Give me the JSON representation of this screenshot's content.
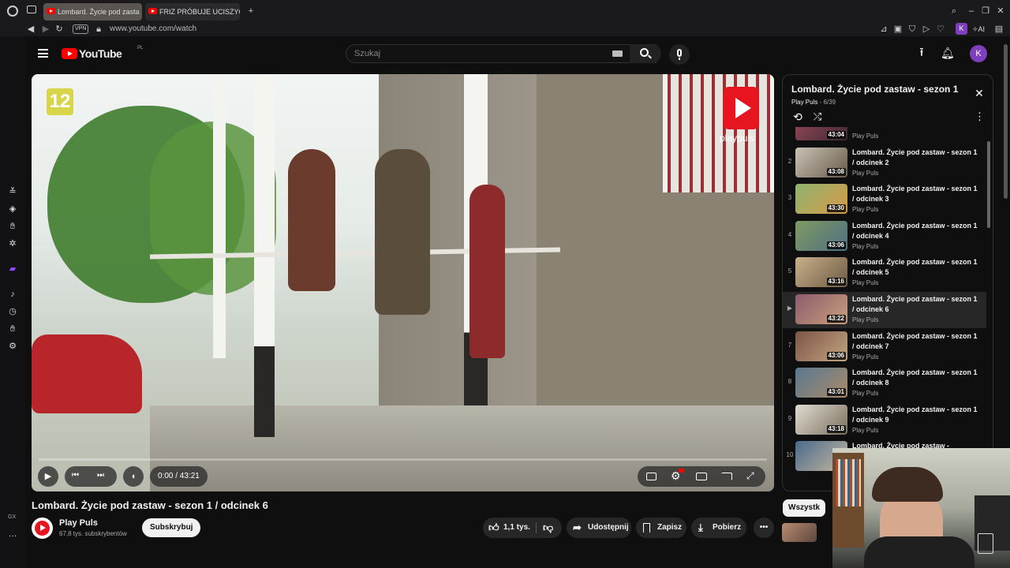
{
  "browser": {
    "tabs": [
      {
        "label": "Lombard. Życie pod zasta",
        "active": true
      },
      {
        "label": "FRIZ PRÓBUJE UCISZYĆ",
        "active": false
      }
    ],
    "vpn_label": "VPN",
    "url": "www.youtube.com/watch",
    "ai_label": "AI",
    "profile_letter": "K",
    "sidebar_bottom_label": "GX"
  },
  "header": {
    "logo_text": "YouTube",
    "region": "PL",
    "search_placeholder": "Szukaj",
    "avatar_letter": "K"
  },
  "player": {
    "channel_badge": "12",
    "watermark": "playpuls",
    "time": "0:00 / 43:21",
    "progress_fraction": 0.0
  },
  "video": {
    "title": "Lombard. Życie pod zastaw - sezon 1 / odcinek 6",
    "channel": "Play Puls",
    "subscribers": "67,8 tys. subskrybentów",
    "subscribe_label": "Subskrybuj",
    "likes": "1,1 tys.",
    "share_label": "Udostępnij",
    "save_label": "Zapisz",
    "download_label": "Pobierz"
  },
  "playlist": {
    "title": "Lombard. Życie pod zastaw - sezon 1",
    "channel": "Play Puls",
    "position": "6/39",
    "items": [
      {
        "index": "",
        "duration": "43:04",
        "title": "",
        "channel": "Play Puls",
        "active": false
      },
      {
        "index": "2",
        "duration": "43:08",
        "title": "Lombard. Życie pod zastaw - sezon 1 / odcinek 2",
        "channel": "Play Puls",
        "active": false
      },
      {
        "index": "3",
        "duration": "43:30",
        "title": "Lombard. Życie pod zastaw - sezon 1 / odcinek 3",
        "channel": "Play Puls",
        "active": false
      },
      {
        "index": "4",
        "duration": "43:06",
        "title": "Lombard. Życie pod zastaw - sezon 1 / odcinek 4",
        "channel": "Play Puls",
        "active": false
      },
      {
        "index": "5",
        "duration": "43:16",
        "title": "Lombard. Życie pod zastaw - sezon 1 / odcinek 5",
        "channel": "Play Puls",
        "active": false
      },
      {
        "index": "▶",
        "duration": "43:22",
        "title": "Lombard. Życie pod zastaw - sezon 1 / odcinek 6",
        "channel": "Play Puls",
        "active": true
      },
      {
        "index": "7",
        "duration": "43:06",
        "title": "Lombard. Życie pod zastaw - sezon 1 / odcinek 7",
        "channel": "Play Puls",
        "active": false
      },
      {
        "index": "8",
        "duration": "43:01",
        "title": "Lombard. Życie pod zastaw - sezon 1 / odcinek 8",
        "channel": "Play Puls",
        "active": false
      },
      {
        "index": "9",
        "duration": "43:18",
        "title": "Lombard. Życie pod zastaw - sezon 1 / odcinek 9",
        "channel": "Play Puls",
        "active": false
      },
      {
        "index": "10",
        "duration": "",
        "title": "Lombard. Życie pod zastaw -",
        "channel": "",
        "active": false
      }
    ]
  },
  "chips": {
    "first": "Wszystk"
  },
  "colors": {
    "brand_red": "#ff0000",
    "avatar_purple": "#7e3fbf",
    "highlight_row": "#272727",
    "badge_yellow": "#d8d54a"
  }
}
